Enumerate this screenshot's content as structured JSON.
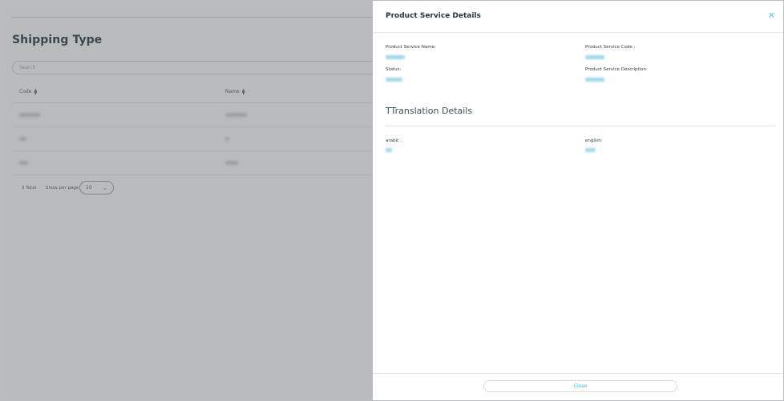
{
  "page": {
    "title": "Shipping Type",
    "search_placeholder": "Search",
    "columns": {
      "code": "Code",
      "name": "Name"
    },
    "pager": {
      "total": "3 Total",
      "per_page_label": "Show per page",
      "per_page_value": "10"
    }
  },
  "drawer": {
    "title": "Product Service Details",
    "close_icon": "×",
    "fields": {
      "name_label": "Product Service Name:",
      "code_label": "Product Service Code :",
      "status_label": "Status:",
      "description_label": "Product Service Description:"
    },
    "translation_title": "TTranslation Details",
    "translations": {
      "arabic_label": "arabic :",
      "english_label": "english:"
    },
    "close_button": "Close"
  },
  "colors": {
    "accent": "#3fb8d6",
    "overlay": "rgba(90,94,96,0.42)",
    "text": "#23373f"
  }
}
